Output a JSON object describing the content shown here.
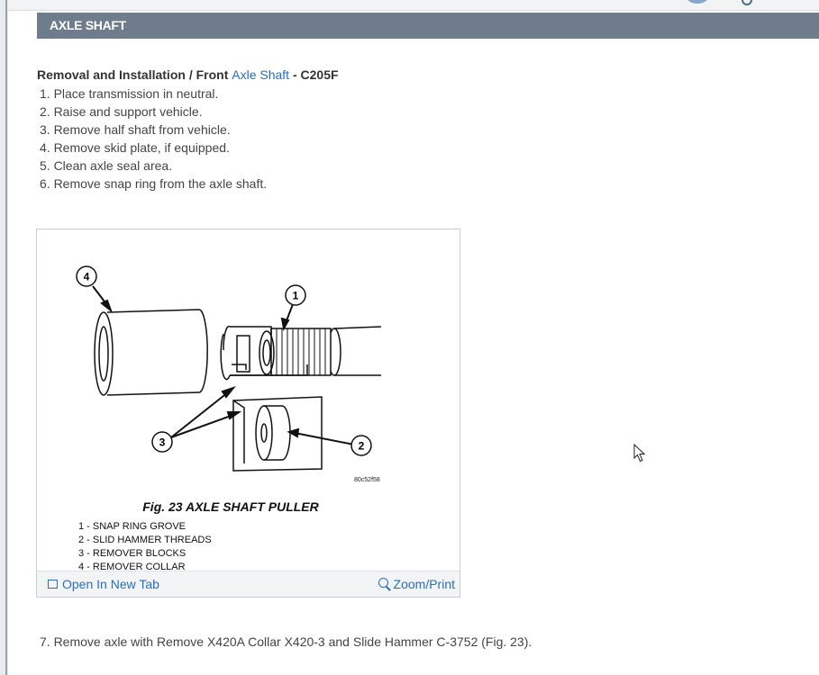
{
  "header": {
    "title": "AXLE SHAFT"
  },
  "section": {
    "prefix": "Removal and Installation / Front",
    "link": "Axle Shaft",
    "suffix": "- C205F"
  },
  "steps": [
    "1. Place transmission in neutral.",
    "2. Raise and support vehicle.",
    "3. Remove half shaft from vehicle.",
    "4. Remove skid plate, if equipped.",
    "5. Clean axle seal area.",
    "6. Remove snap ring from the axle shaft."
  ],
  "figure": {
    "image_code": "80c52f58",
    "caption": "Fig. 23 AXLE SHAFT PULLER",
    "callouts": [
      "1",
      "2",
      "3",
      "4"
    ],
    "legend": [
      "1 - SNAP RING GROVE",
      "2 - SLID HAMMER THREADS",
      "3 - REMOVER BLOCKS",
      "4 - REMOVER COLLAR"
    ],
    "open_label": "Open In New Tab",
    "zoom_label": "Zoom/Print"
  },
  "step7": "7. Remove axle with Remove X420A Collar X420-3 and Slide Hammer C-3752 (Fig. 23).",
  "icons": {
    "open": "open-new-tab-icon",
    "zoom": "zoom-in-icon",
    "cursor": "mouse-pointer-icon"
  }
}
